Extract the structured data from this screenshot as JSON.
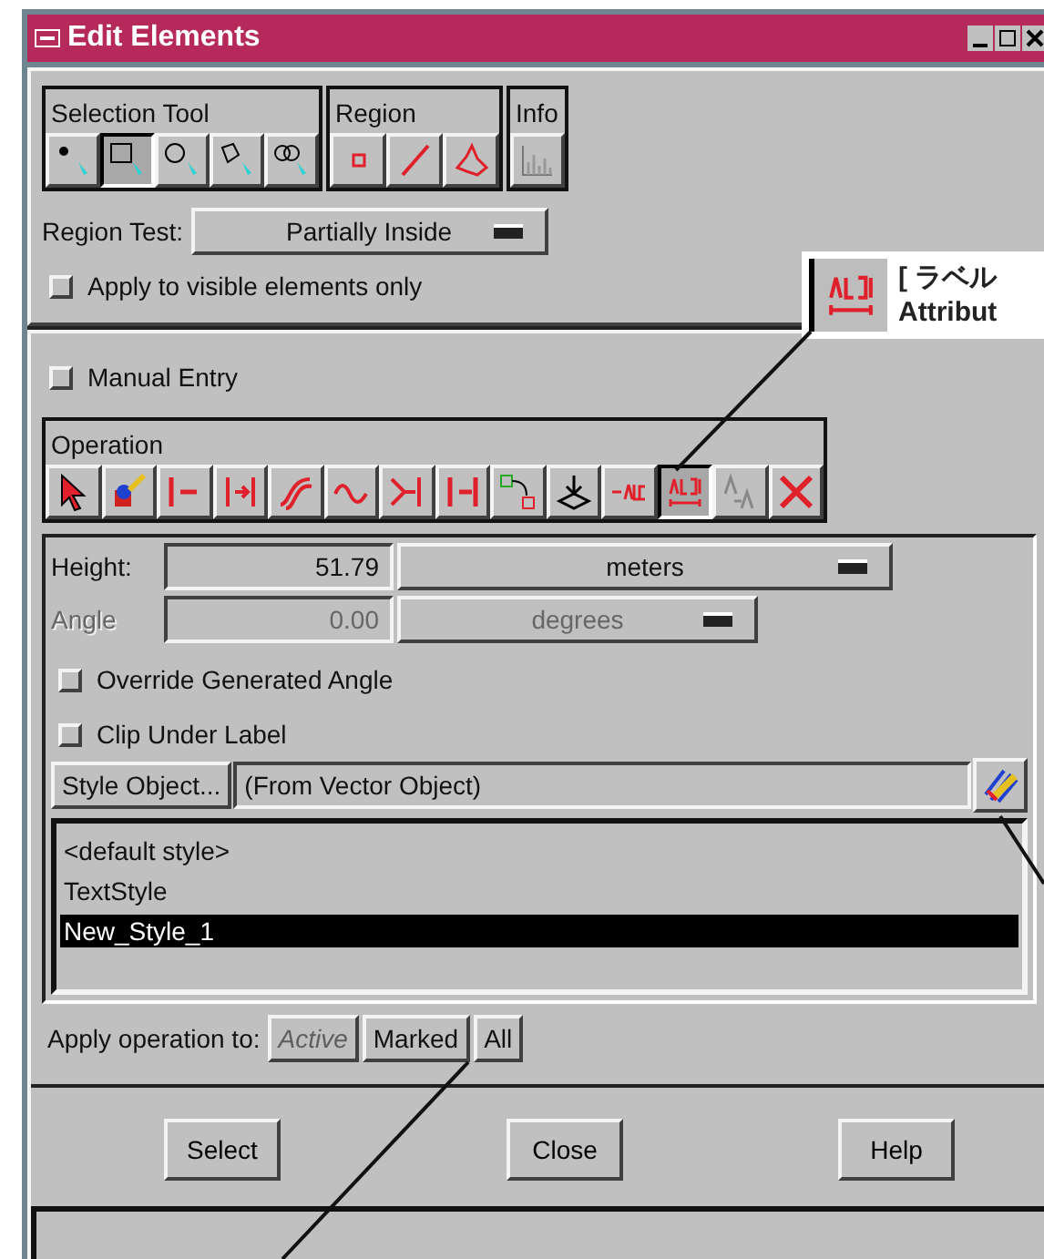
{
  "window": {
    "title": "Edit Elements"
  },
  "selection_tool": {
    "title": "Selection Tool",
    "tools": [
      {
        "selected": false
      },
      {
        "selected": true
      },
      {
        "selected": false
      },
      {
        "selected": false
      },
      {
        "selected": false
      }
    ]
  },
  "region": {
    "title": "Region",
    "tools": [
      {
        "selected": false
      },
      {
        "selected": false
      },
      {
        "selected": false
      }
    ]
  },
  "info": {
    "title": "Info",
    "tools": [
      {
        "selected": false
      }
    ]
  },
  "region_test": {
    "label": "Region Test:",
    "value": "Partially Inside"
  },
  "visible_only": {
    "label": "Apply to visible elements only",
    "checked": false
  },
  "manual_entry": {
    "label": "Manual Entry",
    "checked": false
  },
  "operation": {
    "title": "Operation",
    "tools": [
      {
        "selected": false
      },
      {
        "selected": false
      },
      {
        "selected": false
      },
      {
        "selected": false
      },
      {
        "selected": false
      },
      {
        "selected": false
      },
      {
        "selected": false
      },
      {
        "selected": false
      },
      {
        "selected": false
      },
      {
        "selected": false
      },
      {
        "selected": false
      },
      {
        "selected": true
      },
      {
        "selected": false
      },
      {
        "selected": false
      }
    ]
  },
  "height": {
    "label": "Height:",
    "value": "51.79",
    "unit": "meters",
    "disabled": false
  },
  "angle": {
    "label": "Angle",
    "value": "0.00",
    "unit": "degrees",
    "disabled": true
  },
  "override_angle": {
    "label": "Override Generated Angle",
    "checked": false
  },
  "clip_under_label": {
    "label": "Clip Under Label",
    "checked": false
  },
  "style_object": {
    "button": "Style Object...",
    "value": "(From Vector Object)"
  },
  "style_list": [
    {
      "label": "<default style>",
      "selected": false
    },
    {
      "label": "TextStyle",
      "selected": false
    },
    {
      "label": "New_Style_1",
      "selected": true
    }
  ],
  "apply_to": {
    "label": "Apply operation to:",
    "options": [
      {
        "label": "Active",
        "disabled": true
      },
      {
        "label": "Marked",
        "disabled": false
      },
      {
        "label": "All",
        "disabled": false
      }
    ]
  },
  "buttons": [
    "Select",
    "Close",
    "Help"
  ],
  "callout": {
    "lines": [
      "[ ラベル",
      "Attribut"
    ]
  }
}
